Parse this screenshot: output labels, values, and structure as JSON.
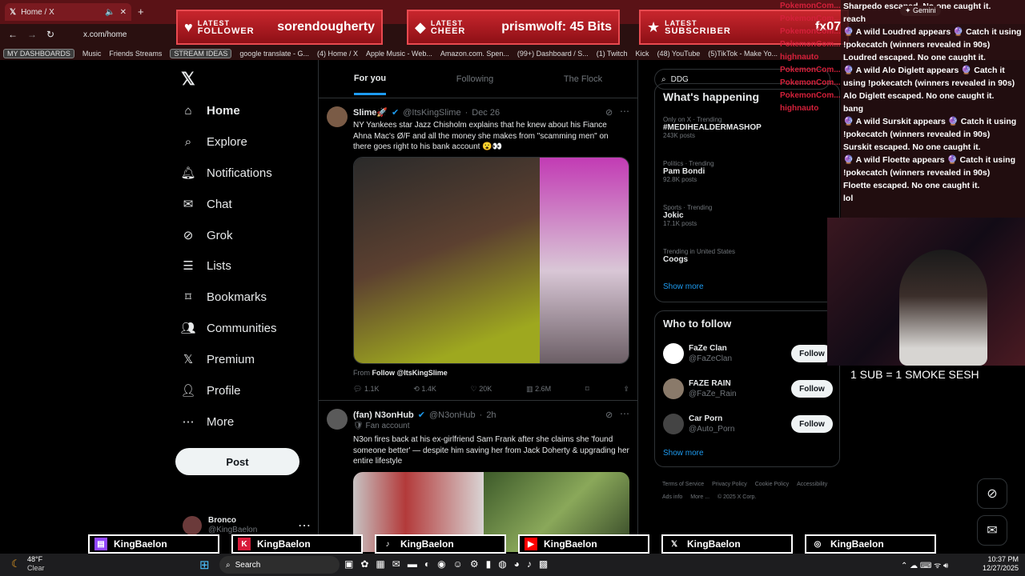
{
  "browser": {
    "tab_title": "Home / X",
    "url": "x.com/home",
    "bookmarks": [
      "MY DASHBOARDS",
      "Music",
      "Friends Streams",
      "STREAM IDEAS",
      "google translate - G...",
      "(4) Home / X",
      "Apple Music - Web...",
      "Amazon.com. Spen...",
      "(99+) Dashboard / S...",
      "(1) Twitch",
      "Kick",
      "(48) YouTube",
      "(5)TikTok - Make Yo..."
    ]
  },
  "banners": {
    "follower": {
      "k1": "LATEST",
      "k2": "FOLLOWER",
      "value": "sorendougherty"
    },
    "cheer": {
      "k1": "LATEST",
      "k2": "CHEER",
      "value": "prismwolf: 45 Bits"
    },
    "subscriber": {
      "k1": "LATEST",
      "k2": "SUBSCRIBER",
      "value": "fx07"
    }
  },
  "nav": {
    "home": "Home",
    "explore": "Explore",
    "notifications": "Notifications",
    "chat": "Chat",
    "grok": "Grok",
    "lists": "Lists",
    "bookmarks": "Bookmarks",
    "communities": "Communities",
    "premium": "Premium",
    "profile": "Profile",
    "more": "More",
    "post": "Post",
    "account_name": "Bronco",
    "account_handle": "@KingBaelon"
  },
  "feed": {
    "tabs": [
      "For you",
      "Following",
      "The Flock"
    ],
    "tweet1": {
      "name": "Slime🚀",
      "handle": "@ItsKingSlime",
      "time": "Dec 26",
      "text": "NY Yankees star Jazz Chisholm explains that he knew about his Fiance Ahna Mac's Ø/F and all the money she makes from \"scamming men\" on there goes right to his bank account 😮👀",
      "from_prefix": "From",
      "from_link": "Follow @ItsKingSlime",
      "replies": "1.1K",
      "reposts": "1.4K",
      "likes": "20K",
      "views": "2.6M"
    },
    "tweet2": {
      "name": "(fan) N3onHub",
      "handle": "@N3onHub",
      "time": "2h",
      "badge": "Fan account",
      "text": "N3on fires back at his ex-girlfriend Sam Frank after she claims she 'found someone better' — despite him saving her from Jack Doherty & upgrading her entire lifestyle"
    }
  },
  "right": {
    "search_value": "DDG",
    "whats_happening": "What's happening",
    "trends": [
      {
        "cat": "Only on X · Trending",
        "name": "#MEDIHEALDERMASHOP",
        "cnt": "243K posts"
      },
      {
        "cat": "Politics · Trending",
        "name": "Pam Bondi",
        "cnt": "92.8K posts"
      },
      {
        "cat": "Sports · Trending",
        "name": "Jokic",
        "cnt": "17.1K posts"
      },
      {
        "cat": "Trending in United States",
        "name": "Coogs",
        "cnt": ""
      }
    ],
    "show_more": "Show more",
    "who_to_follow": "Who to follow",
    "follows": [
      {
        "name": "FaZe Clan",
        "handle": "@FaZeClan"
      },
      {
        "name": "FAZE RAIN",
        "handle": "@FaZe_Rain"
      },
      {
        "name": "Car Porn",
        "handle": "@Auto_Porn"
      }
    ],
    "follow_label": "Follow",
    "footer": [
      "Terms of Service",
      "Privacy Policy",
      "Cookie Policy",
      "Accessibility",
      "Ads info",
      "More ...",
      "© 2025 X Corp."
    ]
  },
  "chat": {
    "names": [
      "PokemonCom...",
      "PokemonCom...",
      "PokemonCom...",
      "PokemonCom...",
      "highnauto",
      "PokemonCom...",
      "PokemonCom...",
      "PokemonCom...",
      "highnauto"
    ],
    "lines": [
      "Sharpedo escaped. No one caught it.",
      "reach",
      "🔮 A wild Loudred appears 🔮 Catch it using !pokecatch (winners revealed in 90s)",
      "Loudred escaped. No one caught it.",
      "🔮 A wild Alo Diglett appears 🔮 Catch it using !pokecatch (winners revealed in 90s)",
      "Alo Diglett escaped. No one caught it.",
      "bang",
      "🔮 A wild Surskit appears 🔮 Catch it using !pokecatch (winners revealed in 90s)",
      "Surskit escaped. No one caught it.",
      "🔮 A wild Floette appears 🔮 Catch it using !pokecatch (winners revealed in 90s)",
      "Floette escaped. No one caught it.",
      "lol"
    ],
    "gemini": "Gemini"
  },
  "overlay": {
    "cam_caption": "1 SUB = 1 SMOKE SESH"
  },
  "socials": [
    "KingBaelon",
    "KingBaelon",
    "KingBaelon",
    "KingBaelon",
    "KingBaelon",
    "KingBaelon"
  ],
  "taskbar": {
    "temp": "48°F",
    "weather": "Clear",
    "search": "Search",
    "time": "10:37 PM",
    "date": "12/27/2025"
  }
}
